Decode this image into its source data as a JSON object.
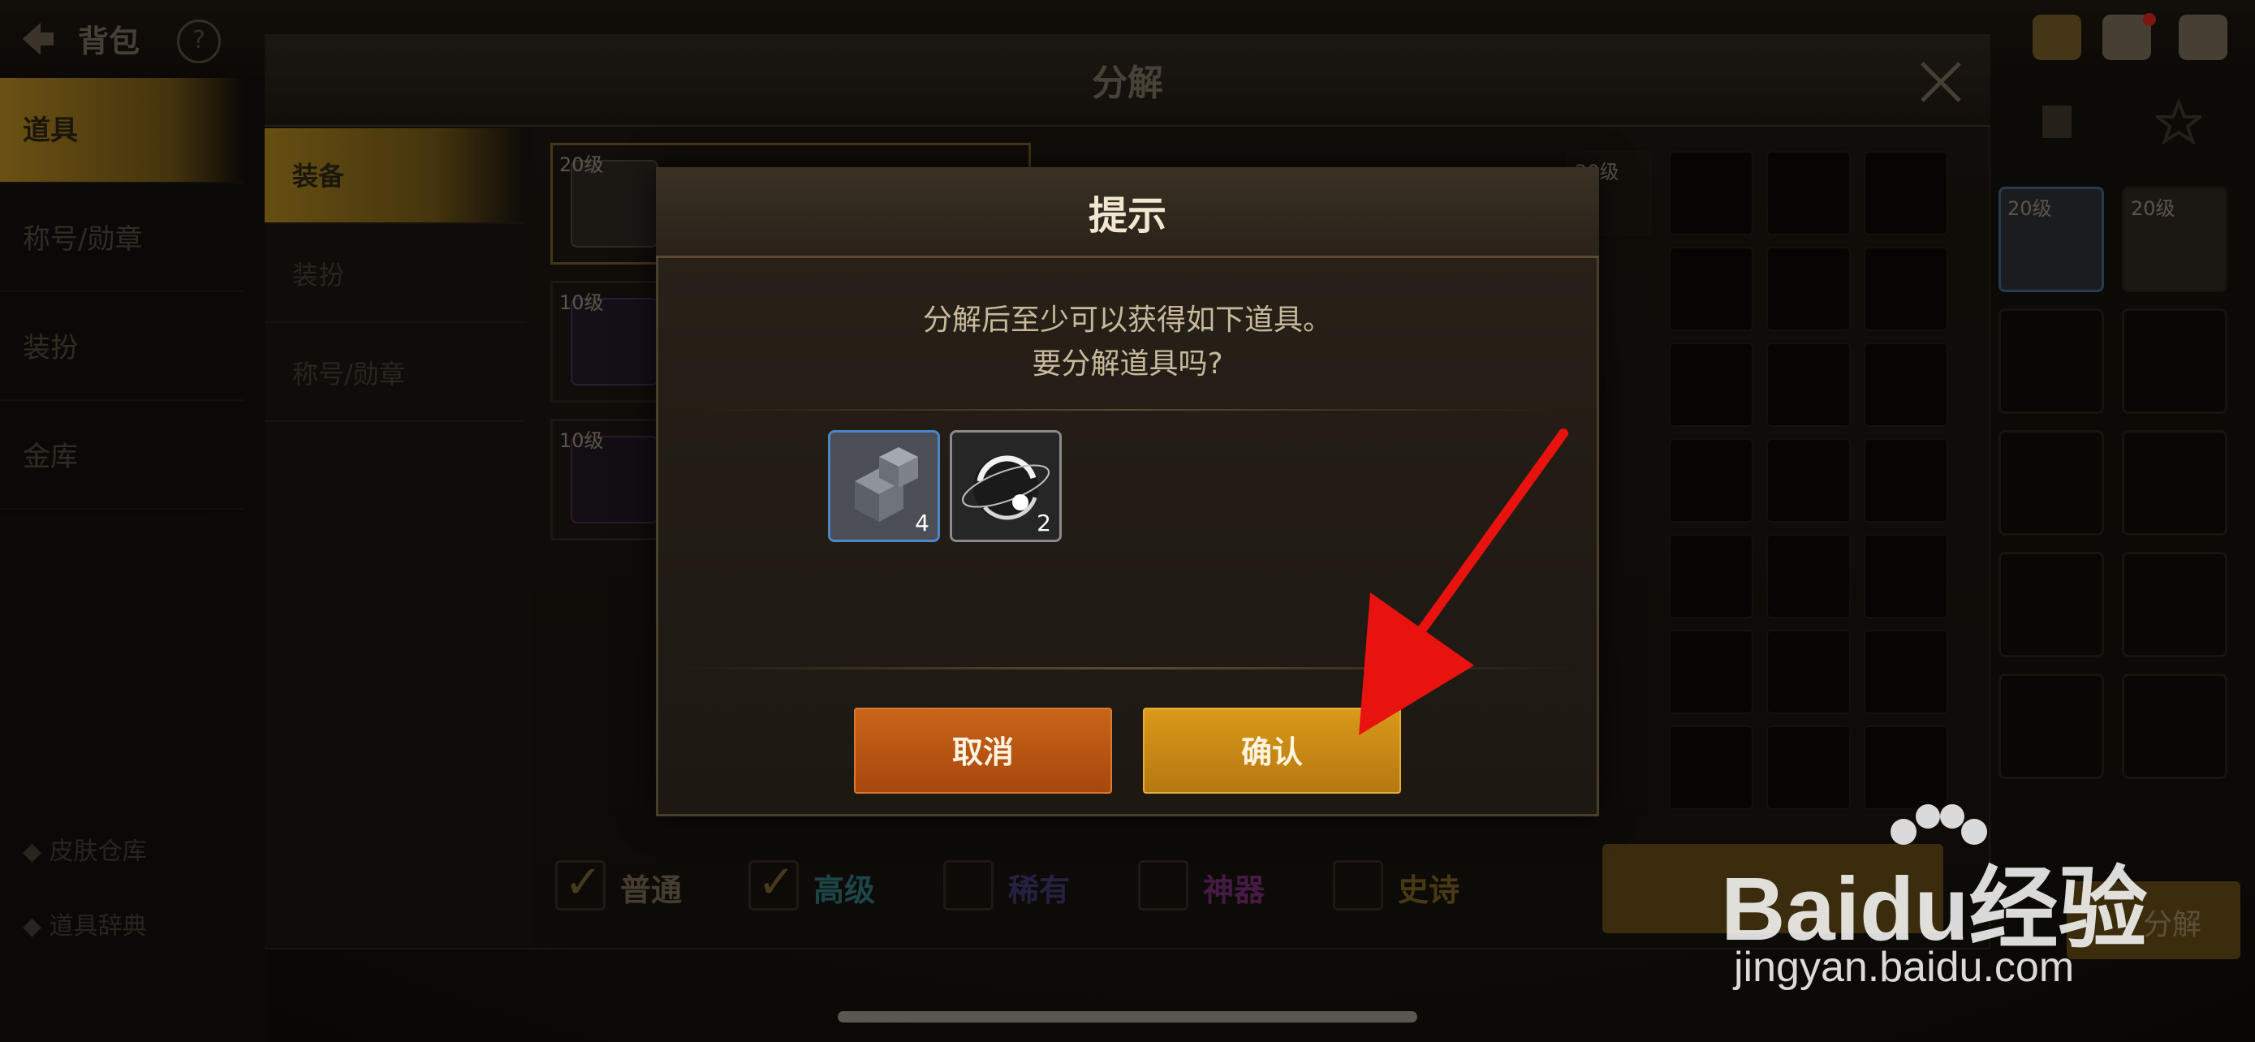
{
  "topbar": {
    "title": "背包",
    "help_label": "?"
  },
  "left_nav": {
    "items": [
      "道具",
      "称号/勋章",
      "装扮",
      "金库"
    ],
    "bottom_items": [
      "皮肤仓库",
      "道具辞典"
    ]
  },
  "panel": {
    "title": "分解",
    "sub_tabs": [
      "装备",
      "装扮",
      "称号/勋章"
    ],
    "list_items": [
      {
        "level": "20级"
      },
      {
        "level": "10级"
      },
      {
        "level": "10级"
      }
    ],
    "right_slots": [
      {
        "level": "20级"
      },
      {
        "level": "20级"
      }
    ],
    "grid_level": "20级",
    "filters": [
      {
        "label": "普通",
        "checked": true,
        "color": "#6a5f4e"
      },
      {
        "label": "高级",
        "checked": true,
        "color": "#2c6a6e"
      },
      {
        "label": "稀有",
        "checked": false,
        "color": "#3a3466"
      },
      {
        "label": "神器",
        "checked": false,
        "color": "#6a2a6a"
      },
      {
        "label": "史诗",
        "checked": false,
        "color": "#6e5a1e"
      }
    ],
    "small_button_label": "分解"
  },
  "dialog": {
    "title": "提示",
    "message_line1": "分解后至少可以获得如下道具。",
    "message_line2": "要分解道具吗?",
    "rewards": [
      {
        "icon": "crystal-cubes-icon",
        "count": "4",
        "border_color": "#4a86c8"
      },
      {
        "icon": "silver-orb-icon",
        "count": "2",
        "border_color": "#8a8a8a"
      }
    ],
    "cancel_label": "取消",
    "confirm_label": "确认"
  },
  "annotation": {
    "icon": "red-arrow-icon",
    "color": "#e8120f"
  },
  "watermark": {
    "brand": "Baidu经验",
    "url": "jingyan.baidu.com"
  }
}
